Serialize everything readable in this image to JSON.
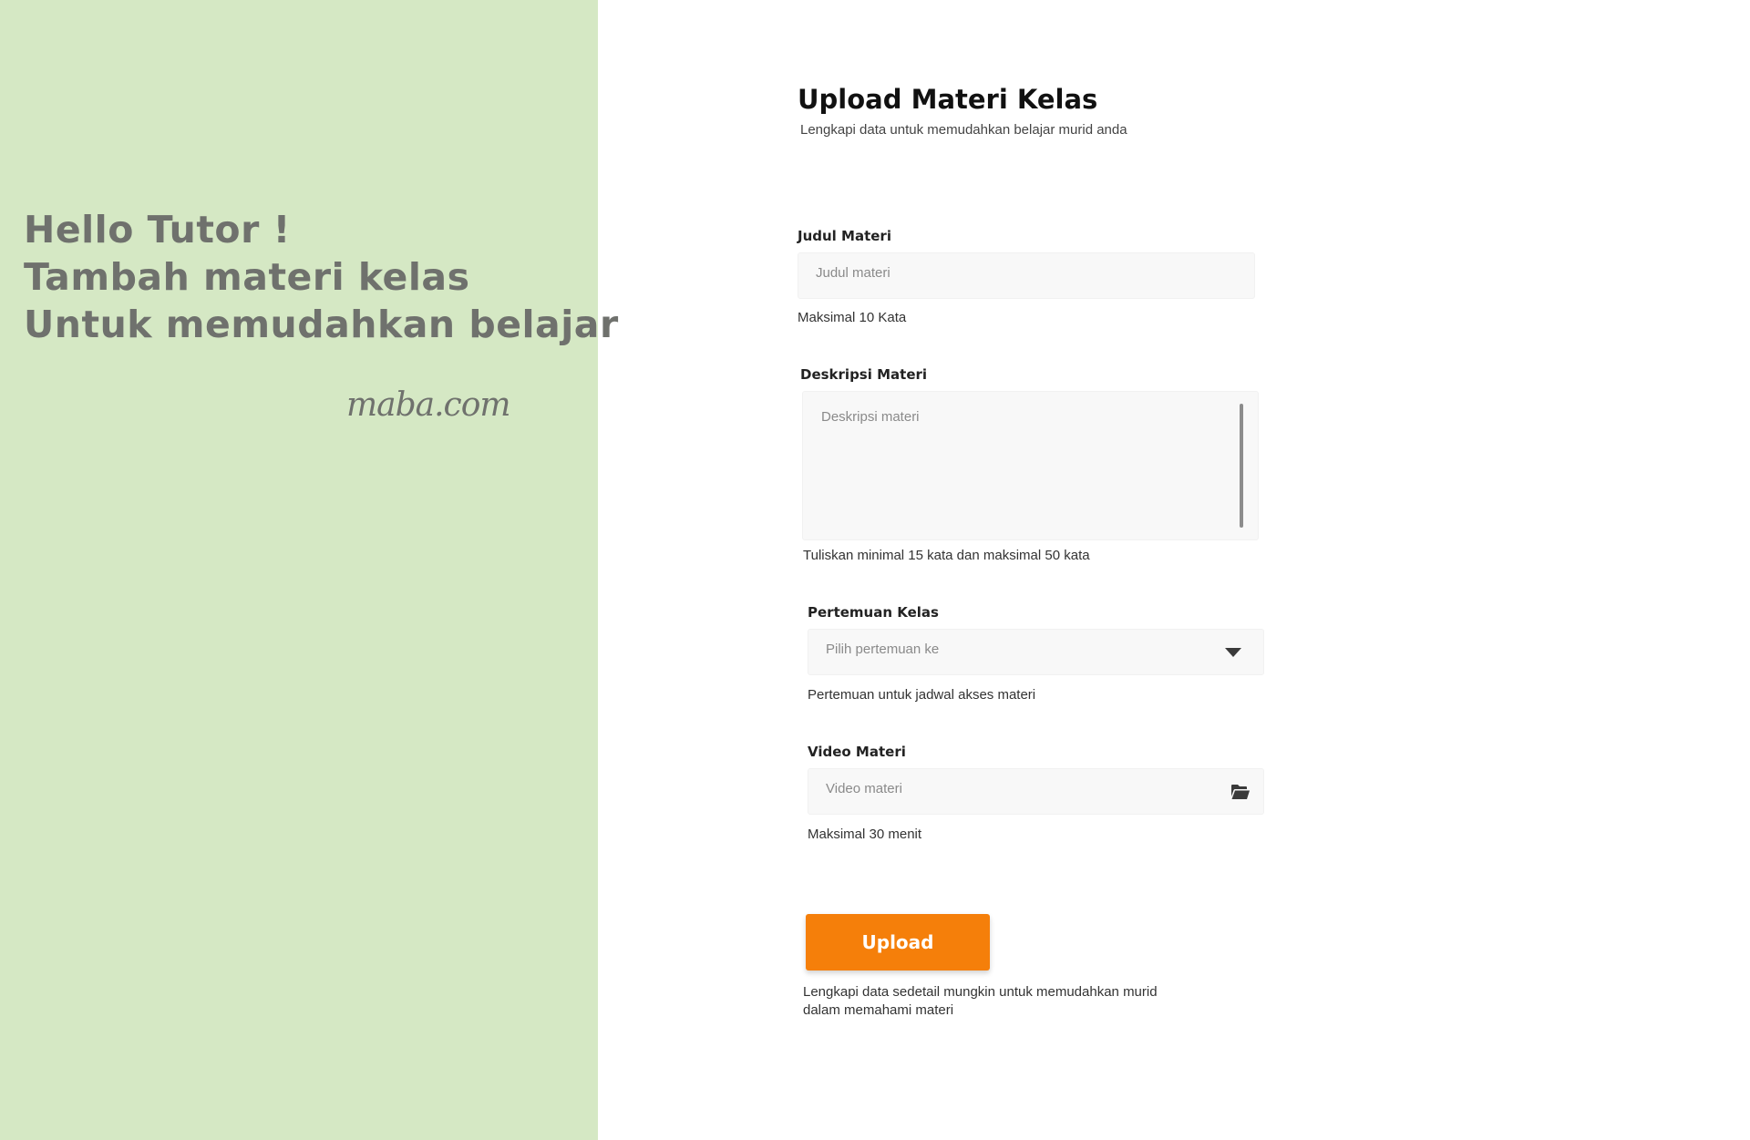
{
  "left_panel": {
    "greeting_lines": [
      "Hello Tutor !",
      "Tambah materi kelas",
      "Untuk memudahkan belajar"
    ],
    "brand": "maba.com",
    "background_color": "#d5e8c4"
  },
  "form": {
    "title": "Upload Materi Kelas",
    "subtitle": "Lengkapi data untuk memudahkan belajar murid anda",
    "fields": {
      "judul": {
        "label": "Judul Materi",
        "placeholder": "Judul materi",
        "value": "",
        "hint": "Maksimal 10 Kata"
      },
      "deskripsi": {
        "label": "Deskripsi Materi",
        "placeholder": "Deskripsi materi",
        "value": "",
        "hint": "Tuliskan minimal 15 kata dan maksimal 50 kata"
      },
      "pertemuan": {
        "label": "Pertemuan Kelas",
        "placeholder": "Pilih pertemuan ke",
        "hint": "Pertemuan untuk jadwal akses materi",
        "icon": "caret-down-icon"
      },
      "video": {
        "label": "Video Materi",
        "placeholder": "Video materi",
        "hint": "Maksimal 30 menit",
        "icon": "folder-open-icon"
      }
    },
    "upload_button": {
      "label": "Upload",
      "color": "#f57f0a"
    },
    "footer_note": "Lengkapi data sedetail mungkin untuk memudahkan murid dalam memahami materi"
  }
}
